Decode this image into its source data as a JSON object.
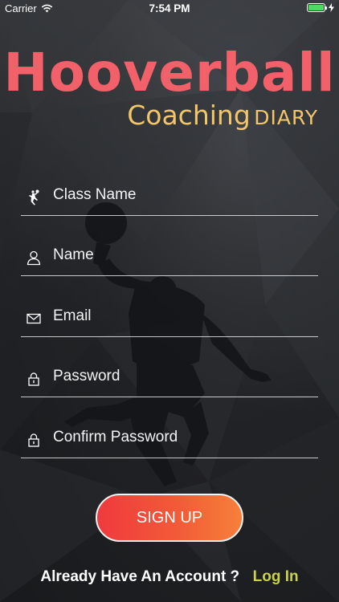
{
  "status_bar": {
    "carrier": "Carrier",
    "time": "7:54 PM"
  },
  "logo": {
    "title": "Hooverball",
    "subtitle_main": "Coaching",
    "subtitle_accent": "DIARY"
  },
  "form": {
    "fields": [
      {
        "placeholder": "Class Name",
        "icon": "basketball-player-icon"
      },
      {
        "placeholder": "Name",
        "icon": "user-icon"
      },
      {
        "placeholder": "Email",
        "icon": "mail-icon"
      },
      {
        "placeholder": "Password",
        "icon": "lock-icon"
      },
      {
        "placeholder": "Confirm Password",
        "icon": "lock-icon"
      }
    ],
    "submit_label": "SIGN UP"
  },
  "footer": {
    "question": "Already Have An Account ?",
    "login_label": "Log In"
  },
  "colors": {
    "title": "#f2606a",
    "subtitle": "#f3c66a",
    "button_start": "#ef3a3f",
    "button_end": "#f6803a",
    "login_link": "#c8d24a",
    "battery": "#4cd964"
  }
}
